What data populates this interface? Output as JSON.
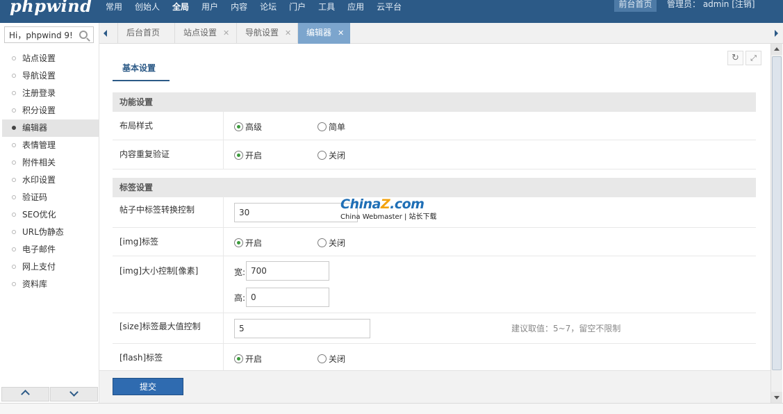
{
  "header": {
    "logo": "phpwind",
    "nav": [
      "常用",
      "创始人",
      "全局",
      "用户",
      "内容",
      "论坛",
      "门户",
      "工具",
      "应用",
      "云平台"
    ],
    "active_nav": "全局",
    "front_page": "前台首页",
    "admin_info": "管理员： admin  [注销]",
    "colors": {
      "bar": "#2c5a87",
      "accent": "#7ca5cd"
    }
  },
  "sidebar": {
    "search_value": "Hi，phpwind 9!",
    "menu": [
      {
        "label": "站点设置",
        "active": false
      },
      {
        "label": "导航设置",
        "active": false
      },
      {
        "label": "注册登录",
        "active": false
      },
      {
        "label": "积分设置",
        "active": false
      },
      {
        "label": "编辑器",
        "active": true
      },
      {
        "label": "表情管理",
        "active": false
      },
      {
        "label": "附件相关",
        "active": false
      },
      {
        "label": "水印设置",
        "active": false
      },
      {
        "label": "验证码",
        "active": false
      },
      {
        "label": "SEO优化",
        "active": false
      },
      {
        "label": "URL伪静态",
        "active": false
      },
      {
        "label": "电子邮件",
        "active": false
      },
      {
        "label": "网上支付",
        "active": false
      },
      {
        "label": "资料库",
        "active": false
      }
    ]
  },
  "tabs": [
    {
      "label": "后台首页",
      "closable": false,
      "active": false
    },
    {
      "label": "站点设置",
      "closable": true,
      "active": false
    },
    {
      "label": "导航设置",
      "closable": true,
      "active": false
    },
    {
      "label": "编辑器",
      "closable": true,
      "active": true
    }
  ],
  "main": {
    "subnav": "基本设置",
    "section_function": "功能设置",
    "layout": {
      "label": "布局样式",
      "options": [
        "高级",
        "简单"
      ],
      "selected": "高级"
    },
    "dup_check": {
      "label": "内容重复验证",
      "options": [
        "开启",
        "关闭"
      ],
      "selected": "开启"
    },
    "section_tags": "标签设置",
    "tag_convert": {
      "label": "帖子中标签转换控制",
      "value": "30"
    },
    "img_tag": {
      "label": "[img]标签",
      "options": [
        "开启",
        "关闭"
      ],
      "selected": "开启"
    },
    "img_size": {
      "label": "[img]大小控制[像素]",
      "width_label": "宽:",
      "width_value": "700",
      "height_label": "高:",
      "height_value": "0"
    },
    "size_tag": {
      "label": "[size]标签最大值控制",
      "value": "5",
      "hint": "建议取值：5~7，留空不限制"
    },
    "flash_tag": {
      "label": "[flash]标签",
      "options": [
        "开启",
        "关闭"
      ],
      "selected": "开启"
    },
    "submit": "提交"
  },
  "watermark": {
    "logo_a": "China",
    "logo_z": "Z",
    "logo_b": ".com",
    "sub": "China Webmaster | 站长下载"
  }
}
